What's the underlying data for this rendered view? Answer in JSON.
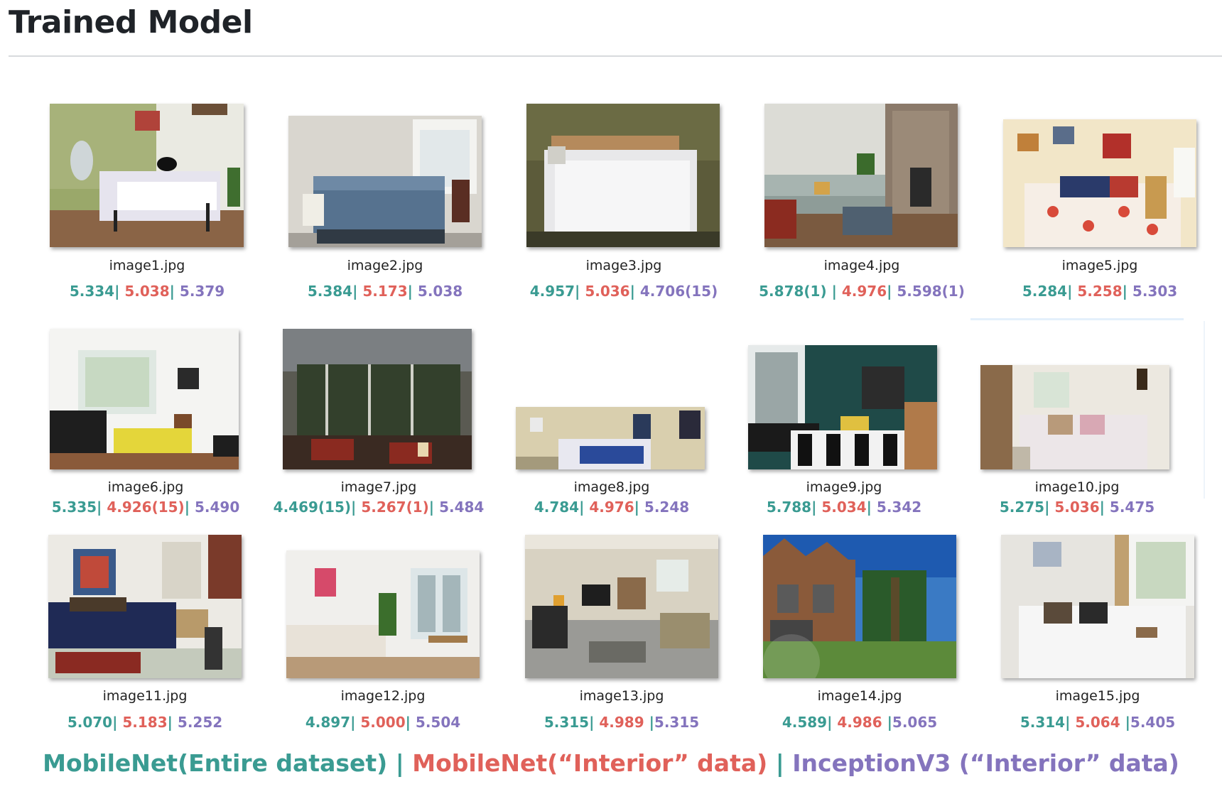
{
  "header": {
    "title": "Trained Model"
  },
  "colors": {
    "mobilenet_entire": "#3a9b92",
    "mobilenet_interior": "#e0615a",
    "inception_interior": "#8474bd"
  },
  "images": [
    {
      "filename": "image1.jpg",
      "s1": "5.334",
      "s2": "5.038",
      "s3": "5.379"
    },
    {
      "filename": "image2.jpg",
      "s1": "5.384",
      "s2": "5.173",
      "s3": "5.038"
    },
    {
      "filename": "image3.jpg",
      "s1": "4.957",
      "s2": "5.036",
      "s3": "4.706(15)"
    },
    {
      "filename": "image4.jpg",
      "s1": "5.878(1)",
      "s2": "4.976",
      "s3": "5.598(1)"
    },
    {
      "filename": "image5.jpg",
      "s1": "5.284",
      "s2": "5.258",
      "s3": "5.303"
    },
    {
      "filename": "image6.jpg",
      "s1": "5.335",
      "s2": "4.926(15)",
      "s3": "5.490"
    },
    {
      "filename": "image7.jpg",
      "s1": "4.469(15)",
      "s2": "5.267(1)",
      "s3": "5.484"
    },
    {
      "filename": "image8.jpg",
      "s1": "4.784",
      "s2": "4.976",
      "s3": "5.248"
    },
    {
      "filename": "image9.jpg",
      "s1": "5.788",
      "s2": "5.034",
      "s3": "5.342"
    },
    {
      "filename": "image10.jpg",
      "s1": "5.275",
      "s2": "5.036",
      "s3": "5.475"
    },
    {
      "filename": "image11.jpg",
      "s1": "5.070",
      "s2": "5.183",
      "s3": "5.252"
    },
    {
      "filename": "image12.jpg",
      "s1": "4.897",
      "s2": "5.000",
      "s3": "5.504"
    },
    {
      "filename": "image13.jpg",
      "s1": "5.315",
      "s2": "4.989",
      "s3": "5.315"
    },
    {
      "filename": "image14.jpg",
      "s1": "4.589",
      "s2": "4.986",
      "s3": "5.065"
    },
    {
      "filename": "image15.jpg",
      "s1": "5.314",
      "s2": "5.064",
      "s3": "5.405"
    }
  ],
  "legend": {
    "mobilenet_entire": "MobileNet(Entire dataset)",
    "mobilenet_interior": "MobileNet(“Interior” data)",
    "inception_interior": "InceptionV3 (“Interior” data)",
    "separator": " | "
  }
}
